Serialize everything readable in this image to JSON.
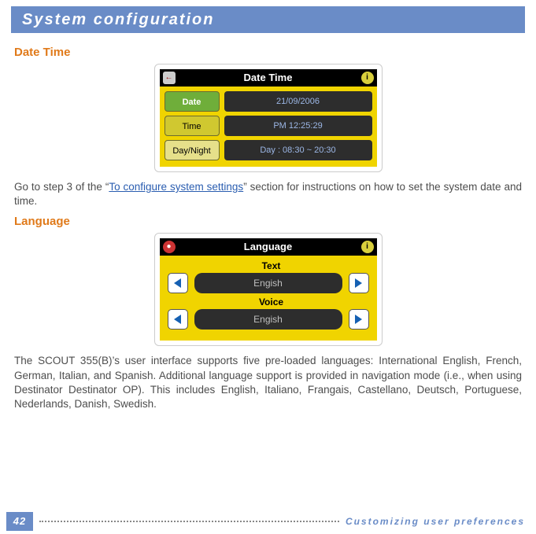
{
  "header": {
    "title": "System configuration"
  },
  "sections": {
    "datetime": {
      "heading": "Date Time",
      "screen_title": "Date Time",
      "rows": [
        {
          "label": "Date",
          "value": "21/09/2006"
        },
        {
          "label": "Time",
          "value": "PM 12:25:29"
        },
        {
          "label": "Day/Night",
          "value": "Day : 08:30 ~ 20:30"
        }
      ],
      "body_prefix": "Go to step 3 of the “",
      "body_link": "To configure system settings",
      "body_suffix": "” section for instructions on how to set the system date and time."
    },
    "language": {
      "heading": "Language",
      "screen_title": "Language",
      "sub1": "Text",
      "value1": "Engish",
      "sub2": "Voice",
      "value2": "Engish",
      "body": "The SCOUT 355(B)’s user interface supports five pre-loaded languages: International English, French, German, Italian, and Spanish. Additional language support is provided in navigation mode (i.e., when using Destinator Destinator OP). This includes English, Italiano, Frangais, Castellano, Deutsch, Portuguese, Nederlands, Danish, Swedish."
    }
  },
  "footer": {
    "page": "42",
    "chapter": "Customizing user preferences"
  },
  "icons": {
    "back": "←",
    "info": "i",
    "globe": "●"
  }
}
